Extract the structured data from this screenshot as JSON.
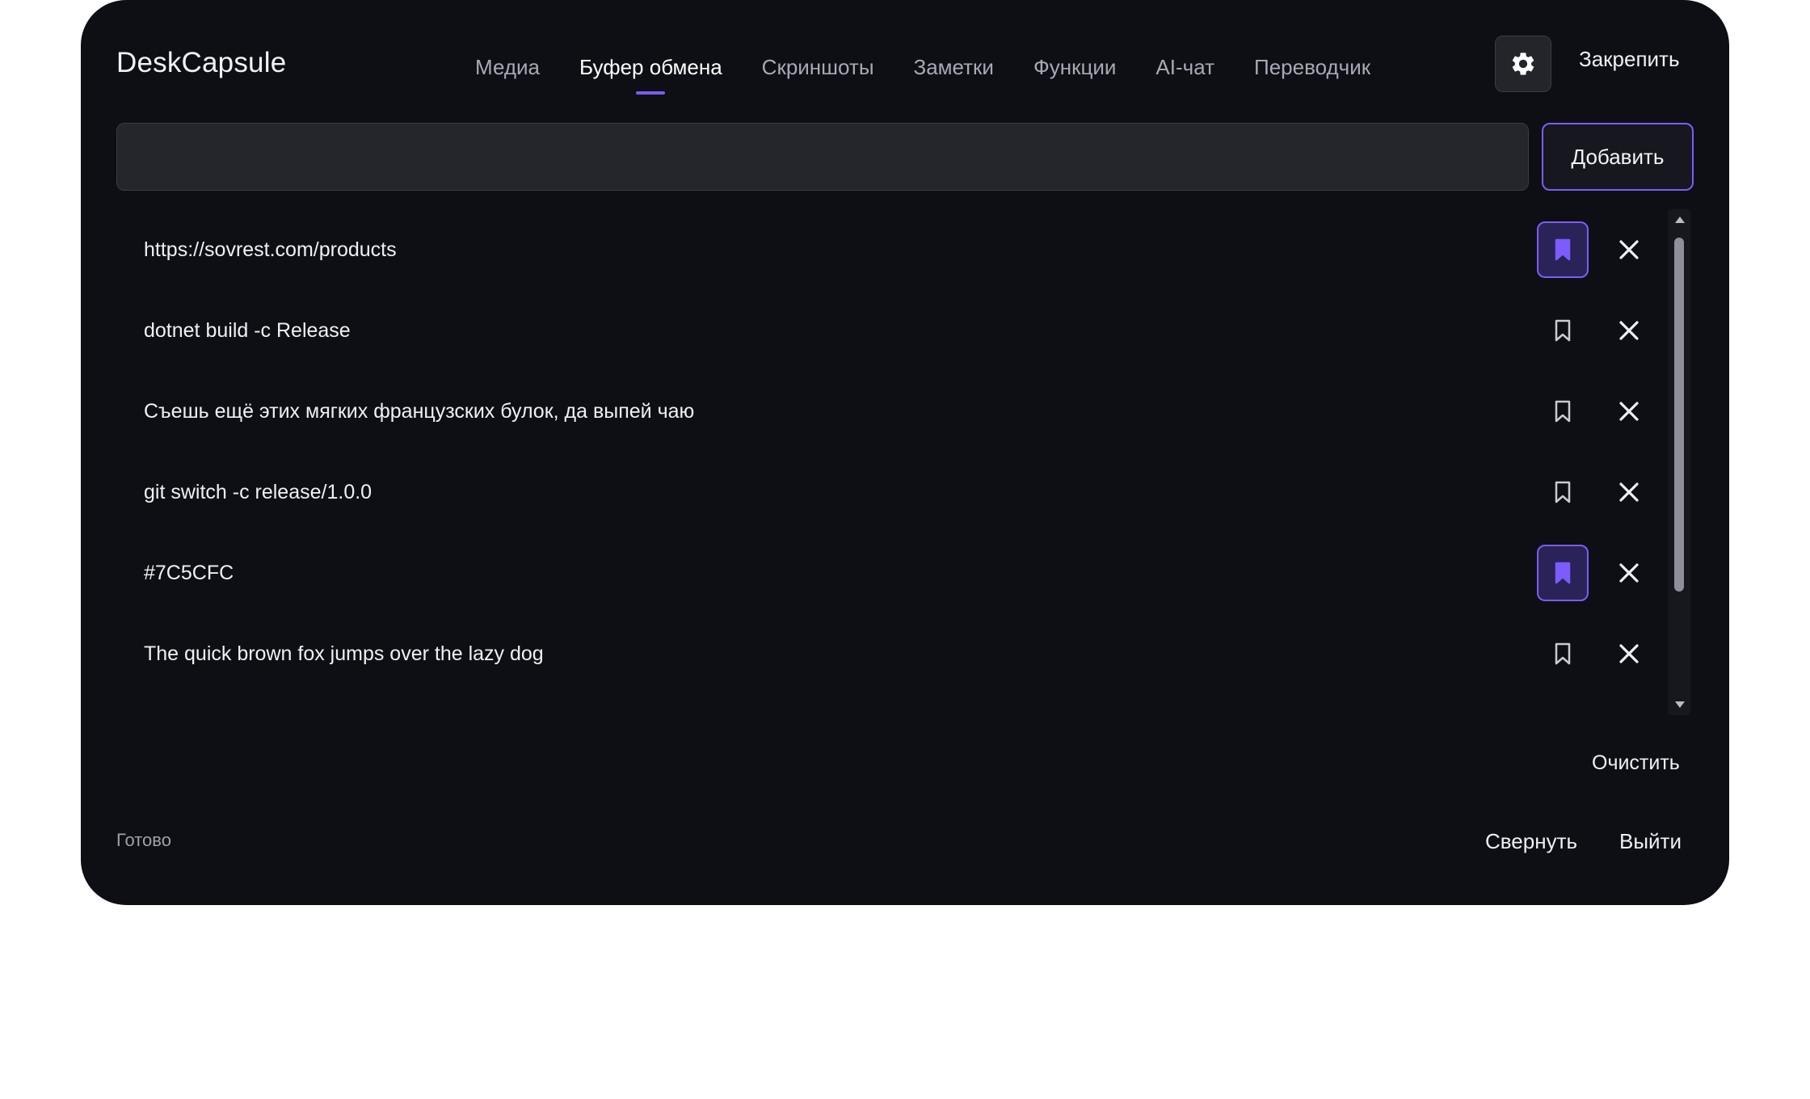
{
  "app": {
    "title": "DeskCapsule",
    "accent_color": "#7c5cfc"
  },
  "nav": {
    "tabs": [
      {
        "label": "Медиа",
        "active": false
      },
      {
        "label": "Буфер обмена",
        "active": true
      },
      {
        "label": "Скриншоты",
        "active": false
      },
      {
        "label": "Заметки",
        "active": false
      },
      {
        "label": "Функции",
        "active": false
      },
      {
        "label": "AI-чат",
        "active": false
      },
      {
        "label": "Переводчик",
        "active": false
      }
    ]
  },
  "header": {
    "settings_icon": "gear-icon",
    "pin_label": "Закрепить"
  },
  "input": {
    "value": "",
    "add_label": "Добавить"
  },
  "clipboard": {
    "items": [
      {
        "text": "https://sovrest.com/products",
        "pinned": true
      },
      {
        "text": "dotnet build -c Release",
        "pinned": false
      },
      {
        "text": "Съешь ещё этих мягких французских булок, да выпей чаю",
        "pinned": false
      },
      {
        "text": "git switch -c release/1.0.0",
        "pinned": false
      },
      {
        "text": "#7C5CFC",
        "pinned": true
      },
      {
        "text": "The quick brown fox jumps over the lazy dog",
        "pinned": false
      }
    ],
    "pin_icon": "bookmark-icon",
    "delete_icon": "close-icon",
    "clear_label": "Очистить"
  },
  "footer": {
    "status": "Готово",
    "collapse_label": "Свернуть",
    "exit_label": "Выйти"
  }
}
